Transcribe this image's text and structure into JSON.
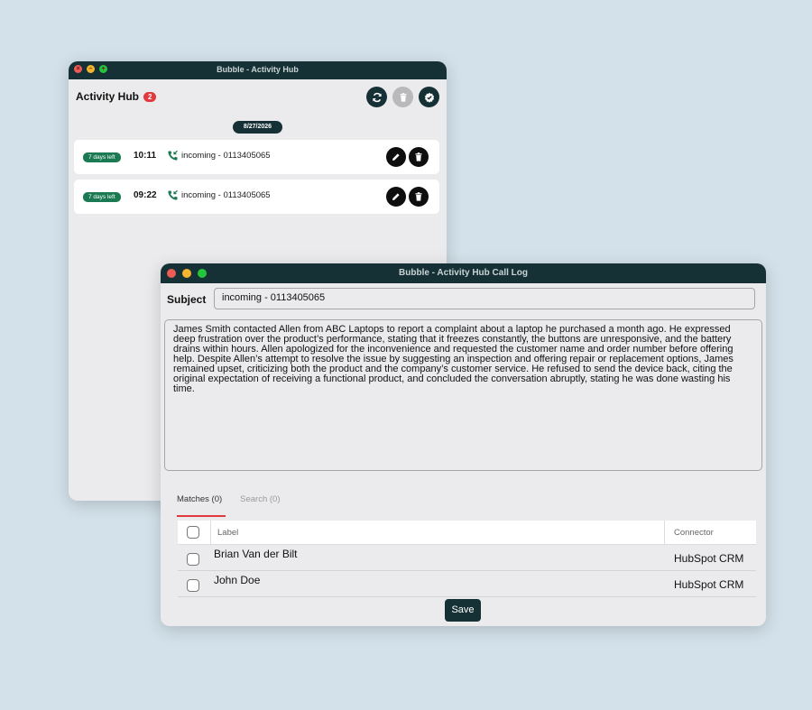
{
  "colors": {
    "accent": "#163136",
    "badge": "#e0393e",
    "days_pill": "#1c7a52",
    "background": "#d3e1ea"
  },
  "hub_window": {
    "title": "Bubble - Activity Hub",
    "header": "Activity Hub",
    "badge_count": "2",
    "actions": [
      "refresh-icon",
      "trash-icon",
      "check-icon"
    ],
    "date": "8/27/2026",
    "activities": [
      {
        "days_left": "7 days left",
        "time": "10:11",
        "icon": "incoming-call-icon",
        "subject": "incoming - 0113405065",
        "actions": [
          "edit-icon",
          "trash-icon"
        ]
      },
      {
        "days_left": "7 days left",
        "time": "09:22",
        "icon": "incoming-call-icon",
        "subject": "incoming - 0113405065",
        "actions": [
          "edit-icon",
          "trash-icon"
        ]
      }
    ]
  },
  "call_log_window": {
    "title": "Bubble - Activity Hub Call Log",
    "subject_label": "Subject",
    "subject_value": "incoming - 0113405065",
    "notes": "James Smith contacted Allen from ABC Laptops to report a complaint about a laptop he purchased a month ago. He expressed deep frustration over the product’s performance, stating that it freezes constantly, the buttons are unresponsive, and the battery drains within hours. Allen apologized for the inconvenience and requested the customer name and order number before offering help. Despite Allen’s attempt to resolve the issue by suggesting an inspection and offering repair or replacement options, James remained upset, criticizing both the product and the company’s customer service. He refused to send the device back, citing the original expectation of receiving a functional product, and concluded the conversation abruptly, stating he was done wasting his time.",
    "tabs": [
      "Matches (0)",
      "Search (0)"
    ],
    "table": {
      "columns": [
        "Label",
        "Connector"
      ],
      "rows": [
        {
          "label": "Brian Van der Bilt",
          "connector": "HubSpot CRM"
        },
        {
          "label": "John Doe",
          "connector": "HubSpot CRM"
        }
      ]
    },
    "save_label": "Save"
  }
}
